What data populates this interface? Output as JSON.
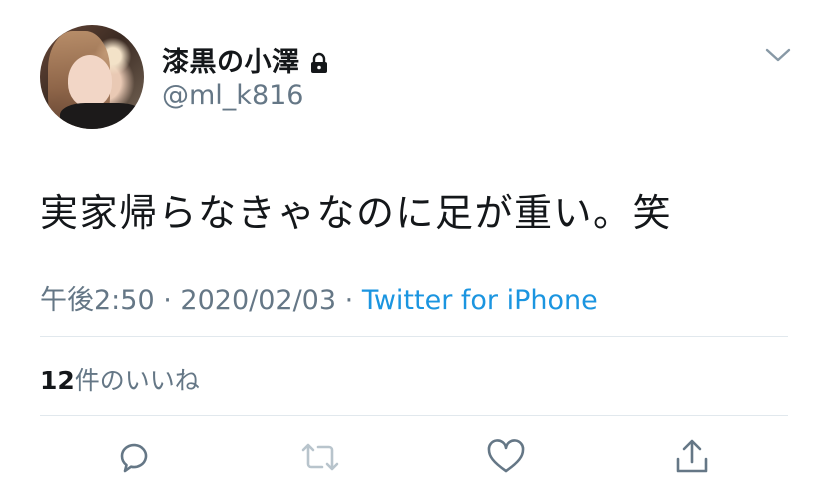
{
  "tweet": {
    "display_name": "漆黒の小澤",
    "handle": "@ml_k816",
    "text": "実家帰らなきゃなのに足が重い。笑",
    "time": "午後2:50",
    "separator": "·",
    "date": "2020/02/03",
    "source": "Twitter for iPhone",
    "likes_count": "12",
    "likes_label": "件のいいね"
  },
  "icons": {
    "lock": "lock-icon",
    "chevron": "chevron-down-icon",
    "reply": "reply-icon",
    "retweet": "retweet-icon",
    "like": "heart-icon",
    "share": "share-icon"
  },
  "colors": {
    "text": "#14171a",
    "secondary": "#657786",
    "link": "#1b95e0",
    "divider": "#e1e8ed",
    "disabled": "#b8c4cc"
  }
}
